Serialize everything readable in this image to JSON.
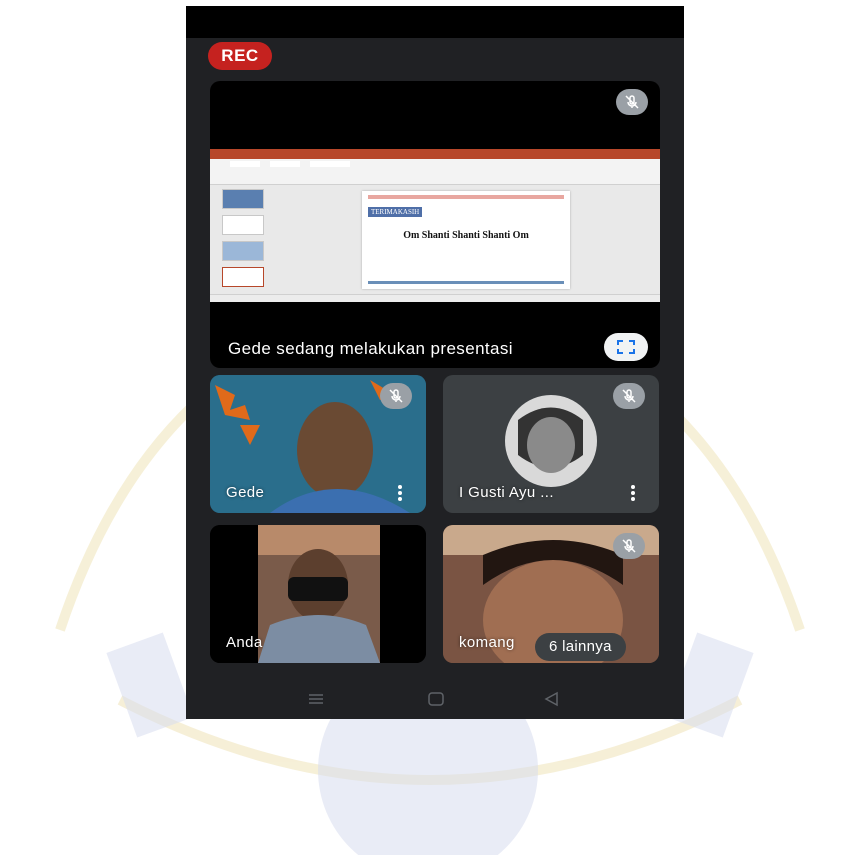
{
  "recording": {
    "label": "REC"
  },
  "presentation": {
    "caption": "Gede sedang melakukan presentasi",
    "slide": {
      "tag": "TERIMAKASIH",
      "text": "Om Shanti Shanti Shanti Om"
    }
  },
  "participants": [
    {
      "name": "Gede",
      "muted": true
    },
    {
      "name": "I Gusti Ayu ...",
      "muted": true
    },
    {
      "name": "Anda",
      "muted": false
    },
    {
      "name": "komang",
      "muted": true
    }
  ],
  "others": {
    "label": "6 lainnya"
  },
  "colors": {
    "rec_red": "#c5221f",
    "app_background": "#202124",
    "tile_background": "#3c4043",
    "mute_badge": "#9aa0a6"
  },
  "icons": {
    "mute": "mic-off-icon",
    "fullscreen": "fullscreen-icon",
    "more": "more-vertical-icon",
    "nav": [
      "recents-icon",
      "home-icon",
      "back-icon"
    ]
  }
}
